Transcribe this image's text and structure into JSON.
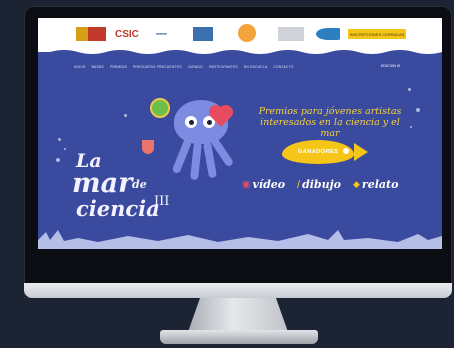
{
  "header": {
    "logos": [
      "gobierno-espana-logo",
      "csic-logo",
      "mar-logo",
      "square-logo",
      "circle-logo",
      "gray-logo",
      "fish-logo"
    ],
    "csic_text": "CSIC",
    "inscription_button": "INSCRIPCIONES CERRADAS"
  },
  "nav": {
    "items": [
      "INICIO",
      "BASES",
      "PREMIOS",
      "PREGUNTAS FRECUENTES",
      "JURADO",
      "PARTICIPANTES",
      "EN ESCUELA",
      "CONTACTO"
    ],
    "right_label": "EDICIÓN III"
  },
  "hero": {
    "title_line1": "La",
    "title_line2": "mar",
    "title_line2b": "de",
    "title_line3": "ciencia",
    "title_roman": "III",
    "promo_line1": "Premios para jóvenes artistas",
    "promo_line2": "interesados en la ciencia y el mar",
    "winners_button": "GANADORES",
    "categories": [
      {
        "icon": "video-icon",
        "label": "vídeo"
      },
      {
        "icon": "pencil-icon",
        "label": "dibujo"
      },
      {
        "icon": "pen-icon",
        "label": "relato"
      }
    ]
  },
  "colors": {
    "sea": "#3a4a9e",
    "accent": "#f5c518",
    "octopus": "#7d8be0"
  }
}
